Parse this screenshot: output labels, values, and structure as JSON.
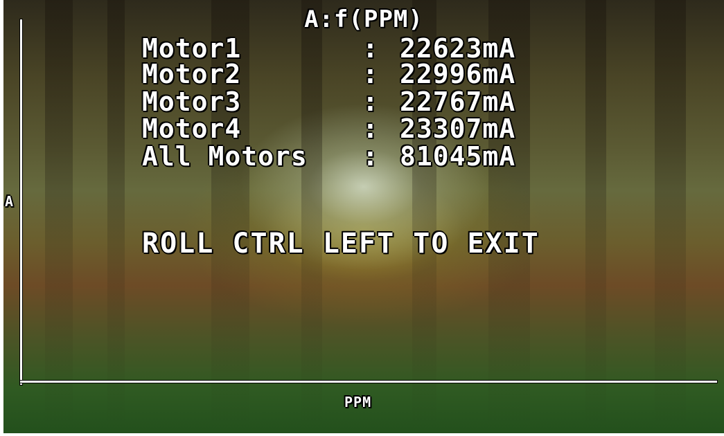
{
  "osd": {
    "title": "A:f(PPM)",
    "readings": [
      {
        "name": "Motor1",
        "sep": ":",
        "value": "22623mA"
      },
      {
        "name": "Motor2",
        "sep": ":",
        "value": "22996mA"
      },
      {
        "name": "Motor3",
        "sep": ":",
        "value": "22767mA"
      },
      {
        "name": "Motor4",
        "sep": ":",
        "value": "23307mA"
      },
      {
        "name": "All Motors",
        "sep": ":",
        "value": "81045mA"
      }
    ],
    "exit_hint": "ROLL CTRL LEFT TO EXIT"
  },
  "graph": {
    "y_axis_label": "A",
    "x_axis_label": "PPM"
  },
  "colors": {
    "text": "#ffffff",
    "outline": "#000000",
    "axis": "#ffffff"
  }
}
